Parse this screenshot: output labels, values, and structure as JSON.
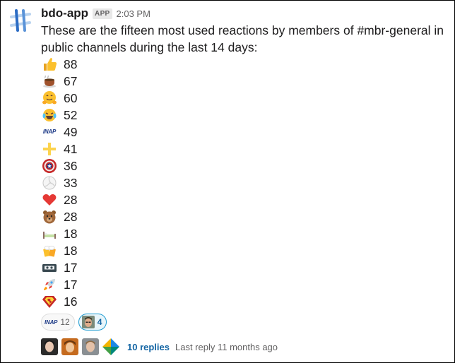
{
  "app": {
    "name": "bdo-app",
    "badge": "APP",
    "time": "2:03 PM"
  },
  "message": {
    "text": "These are the fifteen most used reactions by members of #mbr-general in public channels during the last 14 days:"
  },
  "reactions_list": [
    {
      "icon": "thumbs-up-icon",
      "glyph": "👍",
      "count": "88"
    },
    {
      "icon": "tea-cup-icon",
      "glyph": "☕",
      "count": "67"
    },
    {
      "icon": "hugging-face-icon",
      "glyph": "🤗",
      "count": "60"
    },
    {
      "icon": "tears-of-joy-icon",
      "glyph": "😂",
      "count": "52"
    },
    {
      "icon": "inap-logo-icon",
      "glyph": "INAP",
      "count": "49"
    },
    {
      "icon": "plus-sign-icon",
      "glyph": "✚",
      "count": "41"
    },
    {
      "icon": "captain-shield-icon",
      "glyph": "",
      "count": "36"
    },
    {
      "icon": "volleyball-icon",
      "glyph": "🏐",
      "count": "33"
    },
    {
      "icon": "red-heart-icon",
      "glyph": "❤",
      "count": "28"
    },
    {
      "icon": "bear-face-icon",
      "glyph": "🐻",
      "count": "28"
    },
    {
      "icon": "bed-icon",
      "glyph": "🛏",
      "count": "18"
    },
    {
      "icon": "beer-mugs-icon",
      "glyph": "🍻",
      "count": "18"
    },
    {
      "icon": "cassette-tape-icon",
      "glyph": "📼",
      "count": "17"
    },
    {
      "icon": "rocket-icon",
      "glyph": "🚀",
      "count": "17"
    },
    {
      "icon": "superman-logo-icon",
      "glyph": "",
      "count": "16"
    }
  ],
  "message_reactions": [
    {
      "icon": "inap-logo-icon",
      "label": "INAP",
      "count": "12",
      "active": false
    },
    {
      "icon": "person-face-icon",
      "count": "4",
      "active": true
    }
  ],
  "thread": {
    "replies": "10 replies",
    "last_reply": "Last reply 11 months ago",
    "avatars": [
      "avatar-1",
      "avatar-2",
      "avatar-3",
      "avatar-4"
    ]
  },
  "colors": {
    "link": "#1264a3",
    "muted": "#616061",
    "text": "#1d1c1d",
    "active_border": "#1d9bd1"
  }
}
